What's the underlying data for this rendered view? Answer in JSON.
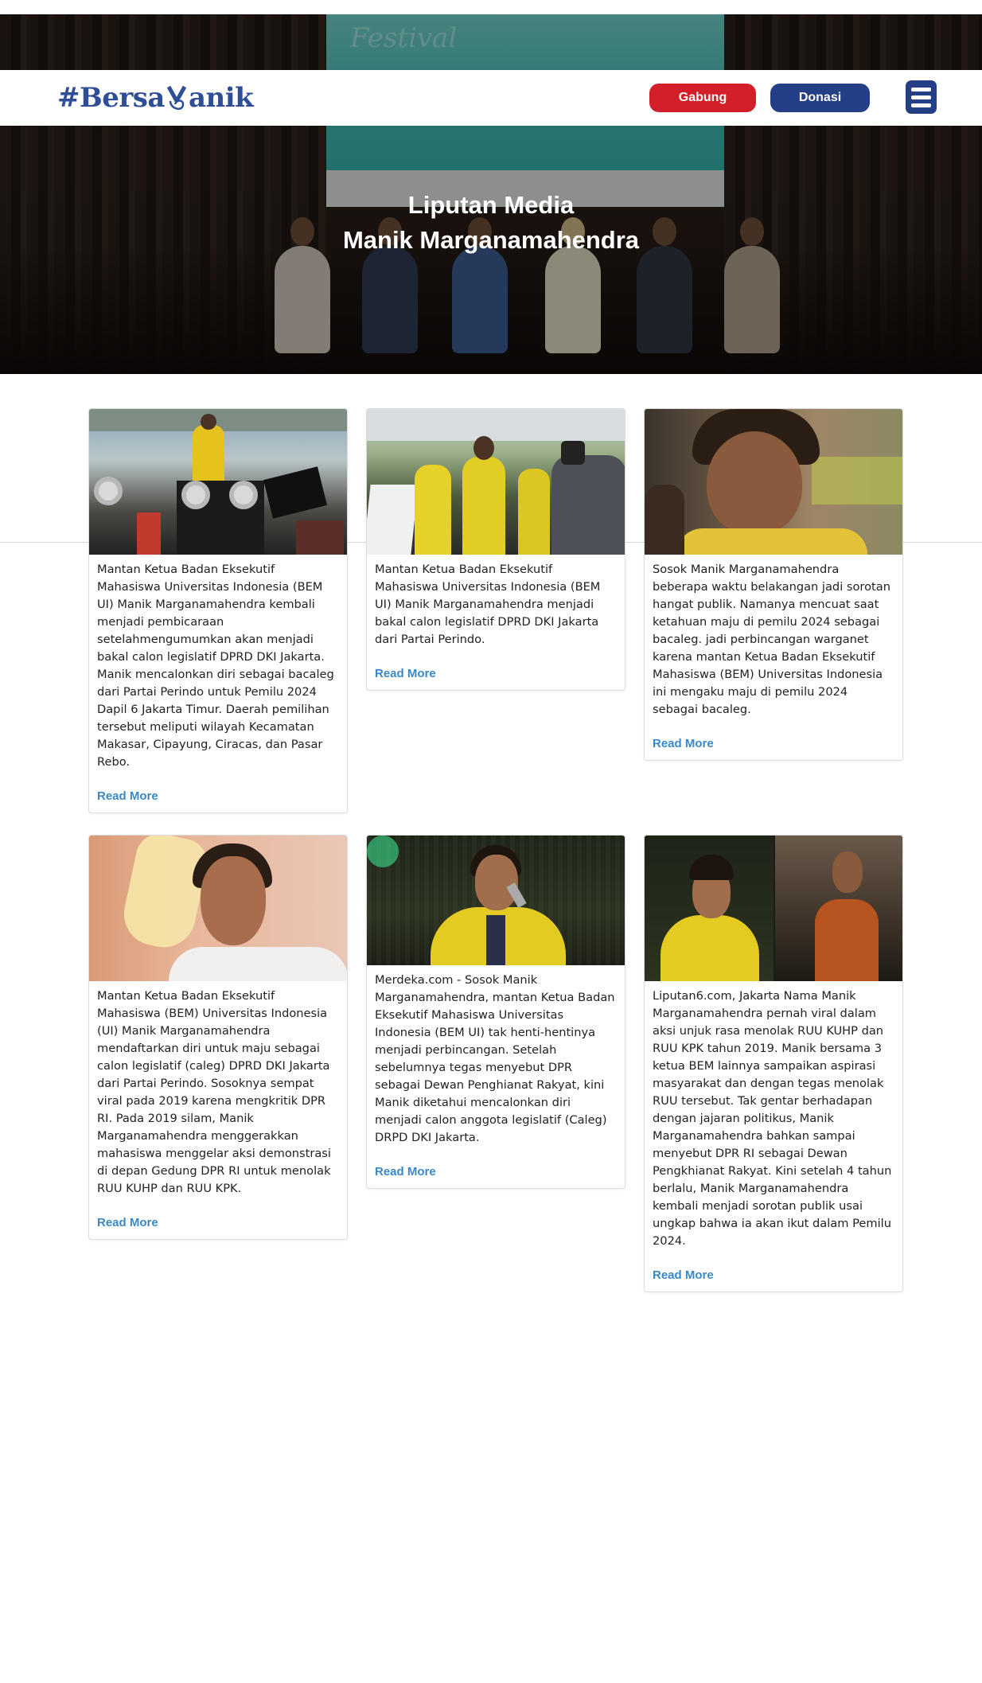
{
  "hero": {
    "title_line1": "Liputan Media",
    "title_line2": "Manik Marganamahendra",
    "screen_text": "Festival"
  },
  "navbar": {
    "logo_text_left": "#Bersa",
    "logo_text_right": "anik",
    "gabung_label": "Gabung",
    "donasi_label": "Donasi"
  },
  "cards": [
    {
      "text": "Mantan Ketua Badan Eksekutif Mahasiswa Universitas Indonesia (BEM UI) Manik Marganamahendra kembali menjadi pembicaraan setelahmengumumkan akan menjadi bakal calon legislatif DPRD DKI Jakarta. Manik mencalonkan diri sebagai bacaleg dari Partai Perindo untuk Pemilu 2024 Dapil 6 Jakarta Timur. Daerah pemilihan tersebut meliputi wilayah Kecamatan Makasar, Cipayung, Ciracas, dan Pasar Rebo.",
      "link": "Read More"
    },
    {
      "text": "Mantan Ketua Badan Eksekutif Mahasiswa Universitas Indonesia (BEM UI) Manik Marganamahendra menjadi bakal calon legislatif DPRD DKI Jakarta dari Partai Perindo.",
      "link": "Read More"
    },
    {
      "text": "Sosok Manik Marganamahendra beberapa waktu belakangan jadi sorotan hangat publik. Namanya mencuat saat ketahuan maju di pemilu 2024 sebagai bacaleg. jadi perbincangan warganet karena mantan Ketua Badan Eksekutif Mahasiswa (BEM) Universitas Indonesia ini mengaku maju di pemilu 2024 sebagai bacaleg.",
      "link": "Read More"
    },
    {
      "text": "Mantan Ketua Badan Eksekutif Mahasiswa (BEM) Universitas Indonesia (UI) Manik Marganamahendra mendaftarkan diri untuk maju sebagai calon legislatif (caleg) DPRD DKI Jakarta dari Partai Perindo. Sosoknya sempat viral pada 2019 karena mengkritik DPR RI. Pada 2019 silam, Manik Marganamahendra menggerakkan mahasiswa menggelar aksi demonstrasi di depan Gedung DPR RI untuk menolak RUU KUHP dan RUU KPK.",
      "link": "Read More"
    },
    {
      "text": "Merdeka.com - Sosok Manik Marganamahendra, mantan Ketua Badan Eksekutif Mahasiswa Universitas Indonesia (BEM UI) tak henti-hentinya menjadi perbincangan. Setelah sebelumnya tegas menyebut DPR sebagai Dewan Penghianat Rakyat, kini Manik diketahui mencalonkan diri menjadi calon anggota legislatif (Caleg) DRPD DKI Jakarta.",
      "link": "Read More"
    },
    {
      "text": "Liputan6.com, Jakarta Nama Manik Marganamahendra pernah viral dalam aksi unjuk rasa menolak RUU KUHP dan RUU KPK tahun 2019. Manik bersama 3 ketua BEM lainnya sampaikan aspirasi masyarakat dan dengan tegas menolak RUU tersebut. Tak gentar berhadapan dengan jajaran politikus, Manik Marganamahendra bahkan sampai menyebut DPR RI sebagai Dewan Pengkhianat Rakyat. Kini setelah 4 tahun berlalu, Manik Marganamahendra kembali menjadi sorotan publik usai ungkap bahwa ia akan ikut dalam Pemilu 2024.",
      "link": "Read More"
    }
  ],
  "colors": {
    "brand_blue": "#243f85",
    "brand_red": "#d21f2a",
    "link_blue": "#3a88c8"
  }
}
